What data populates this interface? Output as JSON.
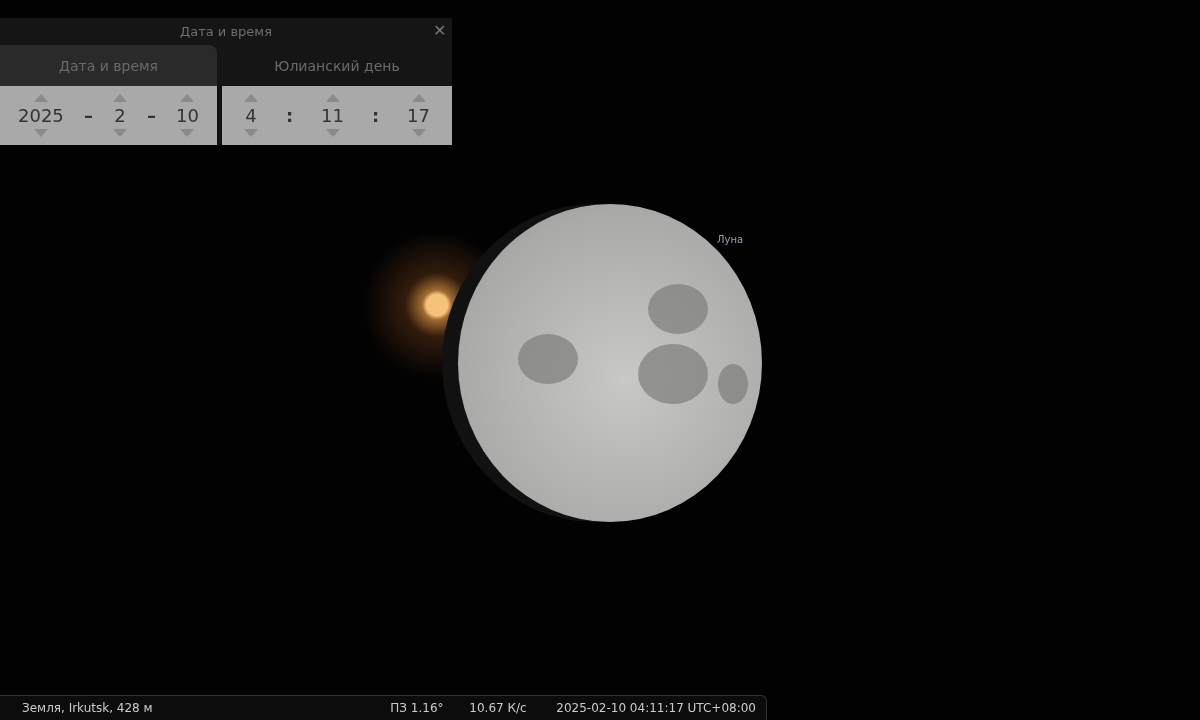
{
  "sky": {
    "moon_label": "Луна"
  },
  "dialog": {
    "title": "Дата и время",
    "close": "✕",
    "tabs": [
      {
        "label": "Дата и время",
        "selected": true
      },
      {
        "label": "Юлианский день",
        "selected": false
      }
    ],
    "panels": [
      {
        "items": [
          {
            "kind": "spin",
            "value": "2025"
          },
          {
            "kind": "sep",
            "text": "–"
          },
          {
            "kind": "spin",
            "value": "2"
          },
          {
            "kind": "sep",
            "text": "–"
          },
          {
            "kind": "spin",
            "value": "10"
          }
        ]
      },
      {
        "items": [
          {
            "kind": "spin",
            "value": "4"
          },
          {
            "kind": "sep",
            "text": ":"
          },
          {
            "kind": "spin",
            "value": "11"
          },
          {
            "kind": "sep",
            "text": ":"
          },
          {
            "kind": "spin",
            "value": "17"
          }
        ]
      }
    ]
  },
  "status_bar": {
    "location": "Земля, Irkutsk, 428 м",
    "fov": "ПЗ 1.16°",
    "fps": "10.67 К/с",
    "datetime": "2025-02-10 04:11:17 UTC+08:00"
  }
}
